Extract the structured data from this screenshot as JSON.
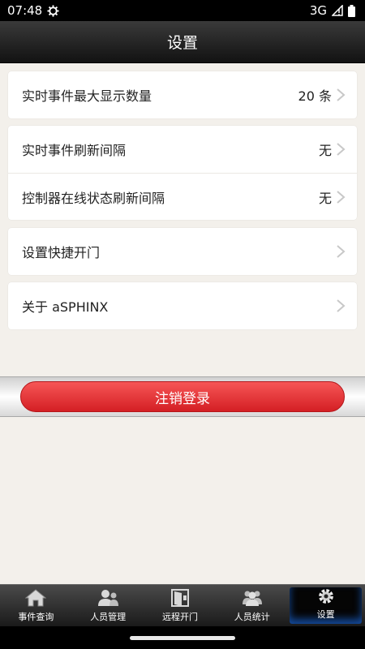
{
  "status_bar": {
    "time": "07:48",
    "network": "3G"
  },
  "header": {
    "title": "设置"
  },
  "settings": {
    "group1": [
      {
        "label": "实时事件最大显示数量",
        "value": "20 条"
      }
    ],
    "group2": [
      {
        "label": "实时事件刷新间隔",
        "value": "无"
      },
      {
        "label": "控制器在线状态刷新间隔",
        "value": "无"
      }
    ],
    "group3": [
      {
        "label": "设置快捷开门",
        "value": ""
      }
    ],
    "group4": [
      {
        "label": "关于 aSPHINX",
        "value": ""
      }
    ]
  },
  "logout": {
    "label": "注销登录"
  },
  "tabs": [
    {
      "label": "事件查询",
      "icon": "home-icon"
    },
    {
      "label": "人员管理",
      "icon": "person-icon"
    },
    {
      "label": "远程开门",
      "icon": "door-icon"
    },
    {
      "label": "人员统计",
      "icon": "group-icon"
    },
    {
      "label": "设置",
      "icon": "gear-icon",
      "active": true
    }
  ],
  "colors": {
    "accent_red": "#e53038",
    "background": "#f3f0eb",
    "header_dark": "#1a1a1a"
  }
}
